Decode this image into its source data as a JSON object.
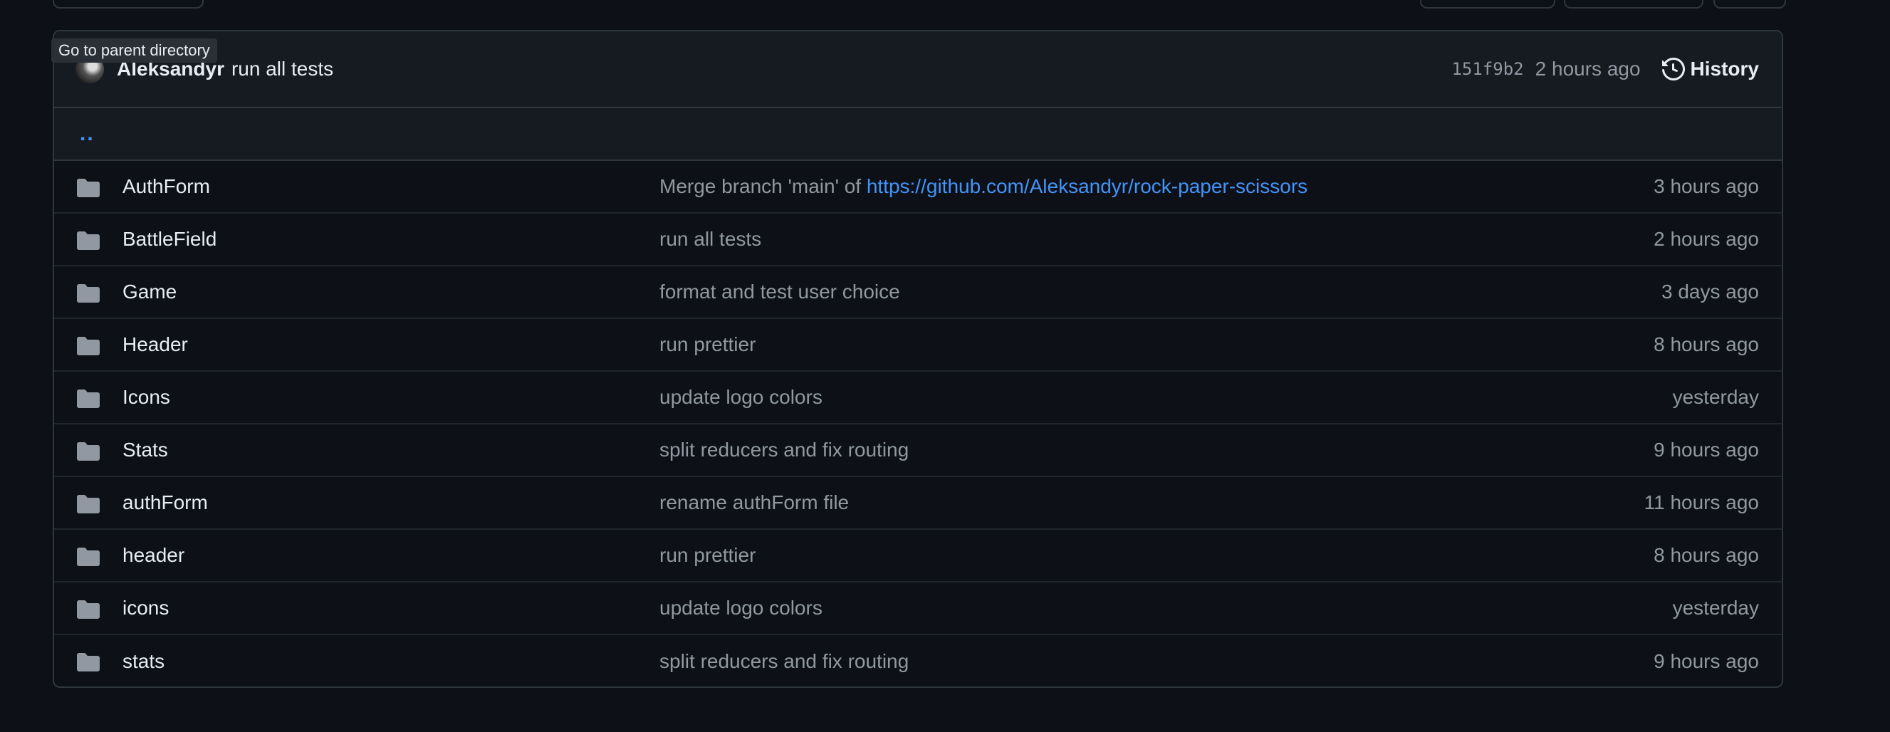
{
  "tooltip": "Go to parent directory",
  "latest_commit": {
    "author": "Aleksandyr",
    "message": "run all tests",
    "sha": "151f9b2",
    "time": "2 hours ago",
    "history_label": "History"
  },
  "parent_dir_label": "..",
  "colors": {
    "background": "#0d1117",
    "header_bg": "#161b22",
    "border": "#30363d",
    "link": "#4493f8",
    "muted": "#9198a1",
    "folder_icon": "#9198a1"
  },
  "rows": [
    {
      "name": "AuthForm",
      "message_prefix": "Merge branch 'main' of ",
      "message_link": "https://github.com/Aleksandyr/rock-paper-scissors",
      "time": "3 hours ago"
    },
    {
      "name": "BattleField",
      "message": "run all tests",
      "time": "2 hours ago"
    },
    {
      "name": "Game",
      "message": "format and test user choice",
      "time": "3 days ago"
    },
    {
      "name": "Header",
      "message": "run prettier",
      "time": "8 hours ago"
    },
    {
      "name": "Icons",
      "message": "update logo colors",
      "time": "yesterday"
    },
    {
      "name": "Stats",
      "message": "split reducers and fix routing",
      "time": "9 hours ago"
    },
    {
      "name": "authForm",
      "message": "rename authForm file",
      "time": "11 hours ago"
    },
    {
      "name": "header",
      "message": "run prettier",
      "time": "8 hours ago"
    },
    {
      "name": "icons",
      "message": "update logo colors",
      "time": "yesterday"
    },
    {
      "name": "stats",
      "message": "split reducers and fix routing",
      "time": "9 hours ago"
    }
  ]
}
